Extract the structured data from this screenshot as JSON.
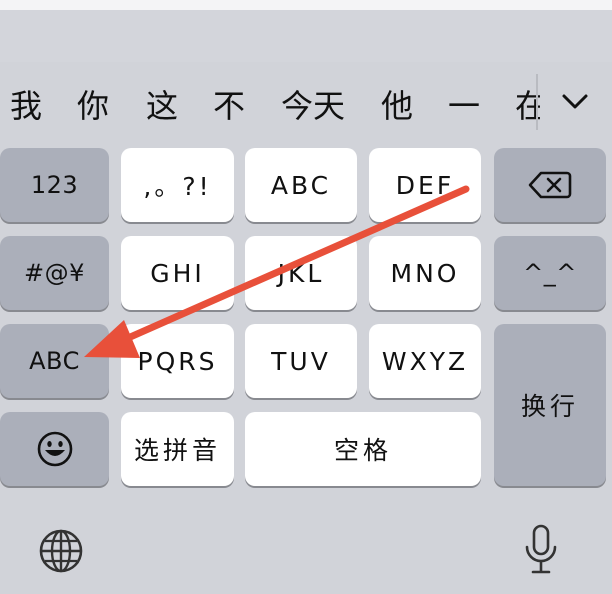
{
  "candidates": [
    "我",
    "你",
    "这",
    "不",
    "今天",
    "他",
    "一",
    "在"
  ],
  "expand_icon": "chevron-down-icon",
  "keys": {
    "numbers": "123",
    "punct": ",。?!",
    "abc": "ABC",
    "def": "DEF",
    "delete_icon": "backspace-icon",
    "symbols": "#@¥",
    "ghi": "GHI",
    "jkl": "JKL",
    "mno": "MNO",
    "emoticon": "^_^",
    "abc_switch": "ABC",
    "pqrs": "PQRS",
    "tuv": "TUV",
    "wxyz": "WXYZ",
    "return": "换行",
    "emoji_icon": "smiley-icon",
    "pinyin_select": "选拼音",
    "space": "空格"
  },
  "bottom_bar": {
    "globe_icon": "globe-icon",
    "mic_icon": "microphone-icon"
  },
  "annotation": {
    "arrow_color": "#e8503a"
  }
}
